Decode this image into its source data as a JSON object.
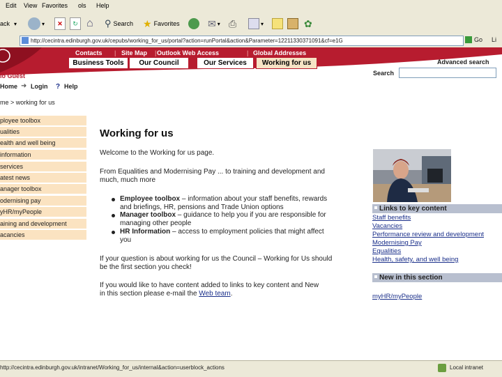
{
  "browser": {
    "menu": [
      "Edit",
      "View",
      "Favorites",
      "ols",
      "Help"
    ],
    "toolbar": {
      "back_partial": "ack",
      "search": "Search",
      "favorites": "Favorites"
    },
    "address": "http://cecintra.edinburgh.gov.uk/cepubs/working_for_us/portal?action=runPortal&action&Parameter=12211330371091&cf=e1G",
    "go_label": "Go",
    "links_label": "Li",
    "status_url": "http://cecintra.edinburgh.gov.uk/intranet/Working_for_us/internal&action=userblock_actions",
    "status_zone": "Local intranet"
  },
  "site": {
    "topnav": [
      "Contacts",
      "Site Map",
      "Outlook Web Access",
      "Global Addresses"
    ],
    "tabs": [
      "Business Tools",
      "Our Council",
      "Our Services",
      "Working for us"
    ],
    "advanced_search": "Advanced search",
    "search_label": "Search",
    "search_value": "",
    "guest": "lo Guest",
    "home": "Home",
    "login": "Login",
    "help": "Help",
    "breadcrumb": "me > working for us",
    "colors": {
      "brand_red": "#b71c2f",
      "side_bg": "#fbe3c1",
      "box_head": "#b8bfcf"
    }
  },
  "sidebar": [
    "ployee toolbox",
    "ualities",
    "ealth and well being",
    "information",
    "services",
    "atest news",
    "anager toolbox",
    "odernising pay",
    "yHR/myPeople",
    "aining and development",
    "acancies"
  ],
  "content": {
    "title": "Working for us",
    "welcome": "Welcome to the Working for us page.",
    "intro_line1": "From Equalities and Modernising Pay ... to training and development and",
    "intro_line2": "much, much more",
    "bullets": [
      {
        "head": "Employee toolbox",
        "line1": " – information about your staff benefits, rewards",
        "line2": "and briefings, HR, pensions and Trade Union options"
      },
      {
        "head": "Manager toolbox",
        "line1": " – guidance to help you if you are responsible for",
        "line2": "managing other people"
      },
      {
        "head": "HR Information",
        "line1": " – access to employment policies that might affect",
        "line2": "you"
      }
    ],
    "question_line1": "If your question is about working for us the Council – Working for Us should",
    "question_line2": "be the first section you check!",
    "add_line1": "If you would like to have content added to links to key content and New",
    "add_line2": "in this section please e-mail the ",
    "web_team": "Web team",
    "add_end": "."
  },
  "right": {
    "links_head": "Links to key content",
    "links": [
      "Staff benefits",
      "Vacancies",
      "Performance review and development",
      "Modernising Pay",
      "Equalities",
      "Health, safety, and well being"
    ],
    "new_head": "New in this section",
    "new_links": [
      "myHR/myPeople"
    ]
  }
}
